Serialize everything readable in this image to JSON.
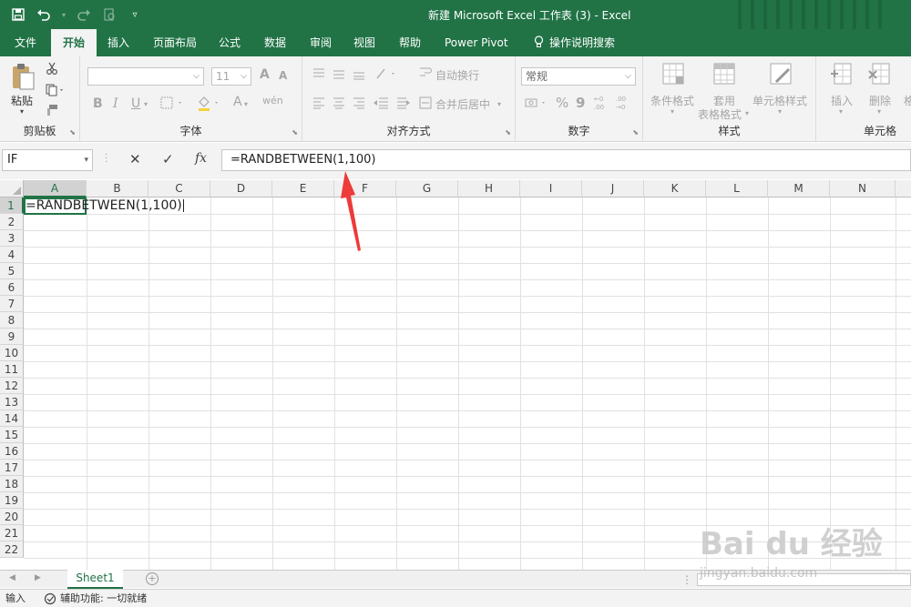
{
  "app": {
    "window_title": "新建 Microsoft Excel 工作表 (3)  -  Excel",
    "brand_color": "#217346"
  },
  "qat": {
    "icons": [
      "save-icon",
      "undo-icon",
      "redo-icon",
      "print-preview-icon",
      "customize-icon"
    ]
  },
  "tabs": [
    {
      "label": "文件",
      "active": false
    },
    {
      "label": "开始",
      "active": true
    },
    {
      "label": "插入",
      "active": false
    },
    {
      "label": "页面布局",
      "active": false
    },
    {
      "label": "公式",
      "active": false
    },
    {
      "label": "数据",
      "active": false
    },
    {
      "label": "审阅",
      "active": false
    },
    {
      "label": "视图",
      "active": false
    },
    {
      "label": "帮助",
      "active": false
    },
    {
      "label": "Power Pivot",
      "active": false
    },
    {
      "label": "操作说明搜索",
      "active": false
    }
  ],
  "ribbon": {
    "clipboard": {
      "label": "剪贴板",
      "paste": "粘贴"
    },
    "font": {
      "label": "字体",
      "font_size": "11",
      "bold": "B",
      "italic": "I",
      "underline": "U",
      "grow": "A",
      "shrink": "A",
      "color": "A",
      "phonetic": "wén"
    },
    "alignment": {
      "label": "对齐方式",
      "wrap": "自动换行",
      "merge": "合并后居中"
    },
    "number": {
      "label": "数字",
      "format": "常规",
      "percent": "%",
      "comma": "9"
    },
    "styles": {
      "label": "样式",
      "conditional": "条件格式",
      "table_line1": "套用",
      "table_line2": "表格格式",
      "cell_styles": "单元格样式"
    },
    "cells": {
      "label": "单元格",
      "insert": "插入",
      "delete": "删除",
      "format": "格"
    }
  },
  "formula_bar": {
    "name_box": "IF",
    "cancel": "✕",
    "enter": "✓",
    "fx": "fx",
    "formula": "=RANDBETWEEN(1,100)"
  },
  "grid": {
    "columns": [
      "A",
      "B",
      "C",
      "D",
      "E",
      "F",
      "G",
      "H",
      "I",
      "J",
      "K",
      "L",
      "M",
      "N"
    ],
    "rows": [
      "1",
      "2",
      "3",
      "4",
      "5",
      "6",
      "7",
      "8",
      "9",
      "10",
      "11",
      "12",
      "13",
      "14",
      "15",
      "16",
      "17",
      "18",
      "19",
      "20",
      "21",
      "22"
    ],
    "active_cell_text": "=RANDBETWEEN(1,100)"
  },
  "sheets": {
    "tabs": [
      "Sheet1"
    ],
    "add": "+"
  },
  "status": {
    "mode": "输入",
    "accessibility": "辅助功能: 一切就绪"
  },
  "watermark": {
    "logo": "Bai du 经验",
    "url": "jingyan.baidu.com"
  }
}
